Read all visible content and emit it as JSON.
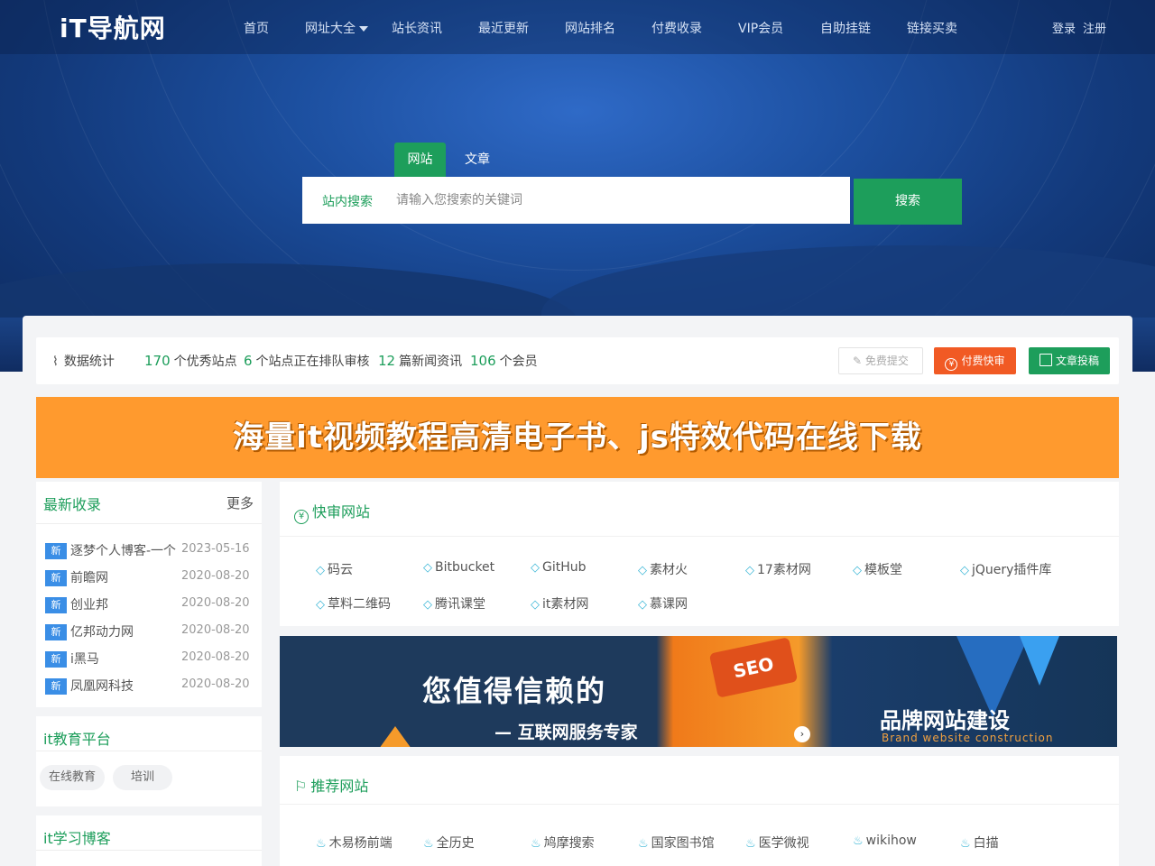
{
  "site": {
    "logo": "iT导航网"
  },
  "nav": {
    "items": [
      {
        "label": "首页"
      },
      {
        "label": "网址大全"
      },
      {
        "label": "站长资讯"
      },
      {
        "label": "最近更新"
      },
      {
        "label": "网站排名"
      },
      {
        "label": "付费收录"
      },
      {
        "label": "VIP会员"
      },
      {
        "label": "自助挂链"
      },
      {
        "label": "链接买卖"
      }
    ],
    "login": "登录",
    "register": "注册"
  },
  "search": {
    "tab_site": "网站",
    "tab_article": "文章",
    "scope_label": "站内搜索",
    "placeholder": "请输入您搜索的关键词",
    "button": "搜索"
  },
  "stats": {
    "title": "数据统计",
    "sites_count": "170",
    "sites_label": "个优秀站点",
    "pending_count": "6",
    "pending_label": "个站点正在排队审核",
    "news_count": "12",
    "news_label": "篇新闻资讯",
    "members_count": "106",
    "members_label": "个会员",
    "btn_free": "免费提交",
    "btn_paid": "付费快审",
    "btn_post": "文章投稿"
  },
  "banner": {
    "text": "海量it视频教程高清电子书、js特效代码在线下载"
  },
  "latest": {
    "title": "最新收录",
    "more": "更多",
    "tag": "新",
    "items": [
      {
        "name": "逐梦个人博客-一个",
        "date": "2023-05-16"
      },
      {
        "name": "前瞻网",
        "date": "2020-08-20"
      },
      {
        "name": "创业邦",
        "date": "2020-08-20"
      },
      {
        "name": "亿邦动力网",
        "date": "2020-08-20"
      },
      {
        "name": "i黑马",
        "date": "2020-08-20"
      },
      {
        "name": "凤凰网科技",
        "date": "2020-08-20"
      }
    ]
  },
  "edu": {
    "title": "it教育平台",
    "tags": [
      "在线教育",
      "培训"
    ]
  },
  "blog": {
    "title": "it学习博客"
  },
  "fast_review": {
    "title": "快审网站",
    "icon": "¥",
    "sites": [
      "码云",
      "Bitbucket",
      "GitHub",
      "素材火",
      "17素材网",
      "模板堂",
      "jQuery插件库",
      "草料二维码",
      "腾讯课堂",
      "it素材网",
      "慕课网"
    ]
  },
  "image_ad": {
    "line1": "您值得信赖的",
    "line2": "— 互联网服务专家",
    "line3": "品牌网站建设",
    "line4": "Brand website construction",
    "seo": "SEO"
  },
  "recommend": {
    "title": "推荐网站",
    "sites": [
      "木易杨前端",
      "全历史",
      "鸠摩搜索",
      "国家图书馆",
      "医学微视",
      "wikihow",
      "白描"
    ]
  },
  "colors": {
    "brand_green": "#1d9e5b",
    "paid_orange": "#f15a24",
    "new_tag_blue": "#3a8ee6",
    "banner_orange": "#ff9a2e"
  }
}
